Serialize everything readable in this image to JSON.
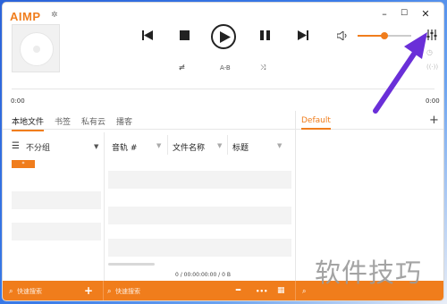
{
  "app": {
    "logo": "AIMP"
  },
  "player": {
    "ab_label": "A-B",
    "time_elapsed": "0:00",
    "time_total": "0:00"
  },
  "tabs": [
    {
      "label": "本地文件"
    },
    {
      "label": "书签"
    },
    {
      "label": "私有云"
    },
    {
      "label": "播客"
    }
  ],
  "library": {
    "group_label": "不分组",
    "columns": [
      "音轨 #",
      "文件名称",
      "标题"
    ]
  },
  "playlist": {
    "tab_label": "Default",
    "status": "0 / 00:00:00:00 / 0 B"
  },
  "bottom_bar": {
    "search_placeholder_left": "快速搜索",
    "search_placeholder_right": "快速搜索",
    "ellipsis": "•••"
  },
  "volume": {
    "level": 0.5
  },
  "watermark": "软件技巧",
  "colors": {
    "accent": "#f07d1c",
    "annotation_arrow": "#6a2fd8"
  }
}
